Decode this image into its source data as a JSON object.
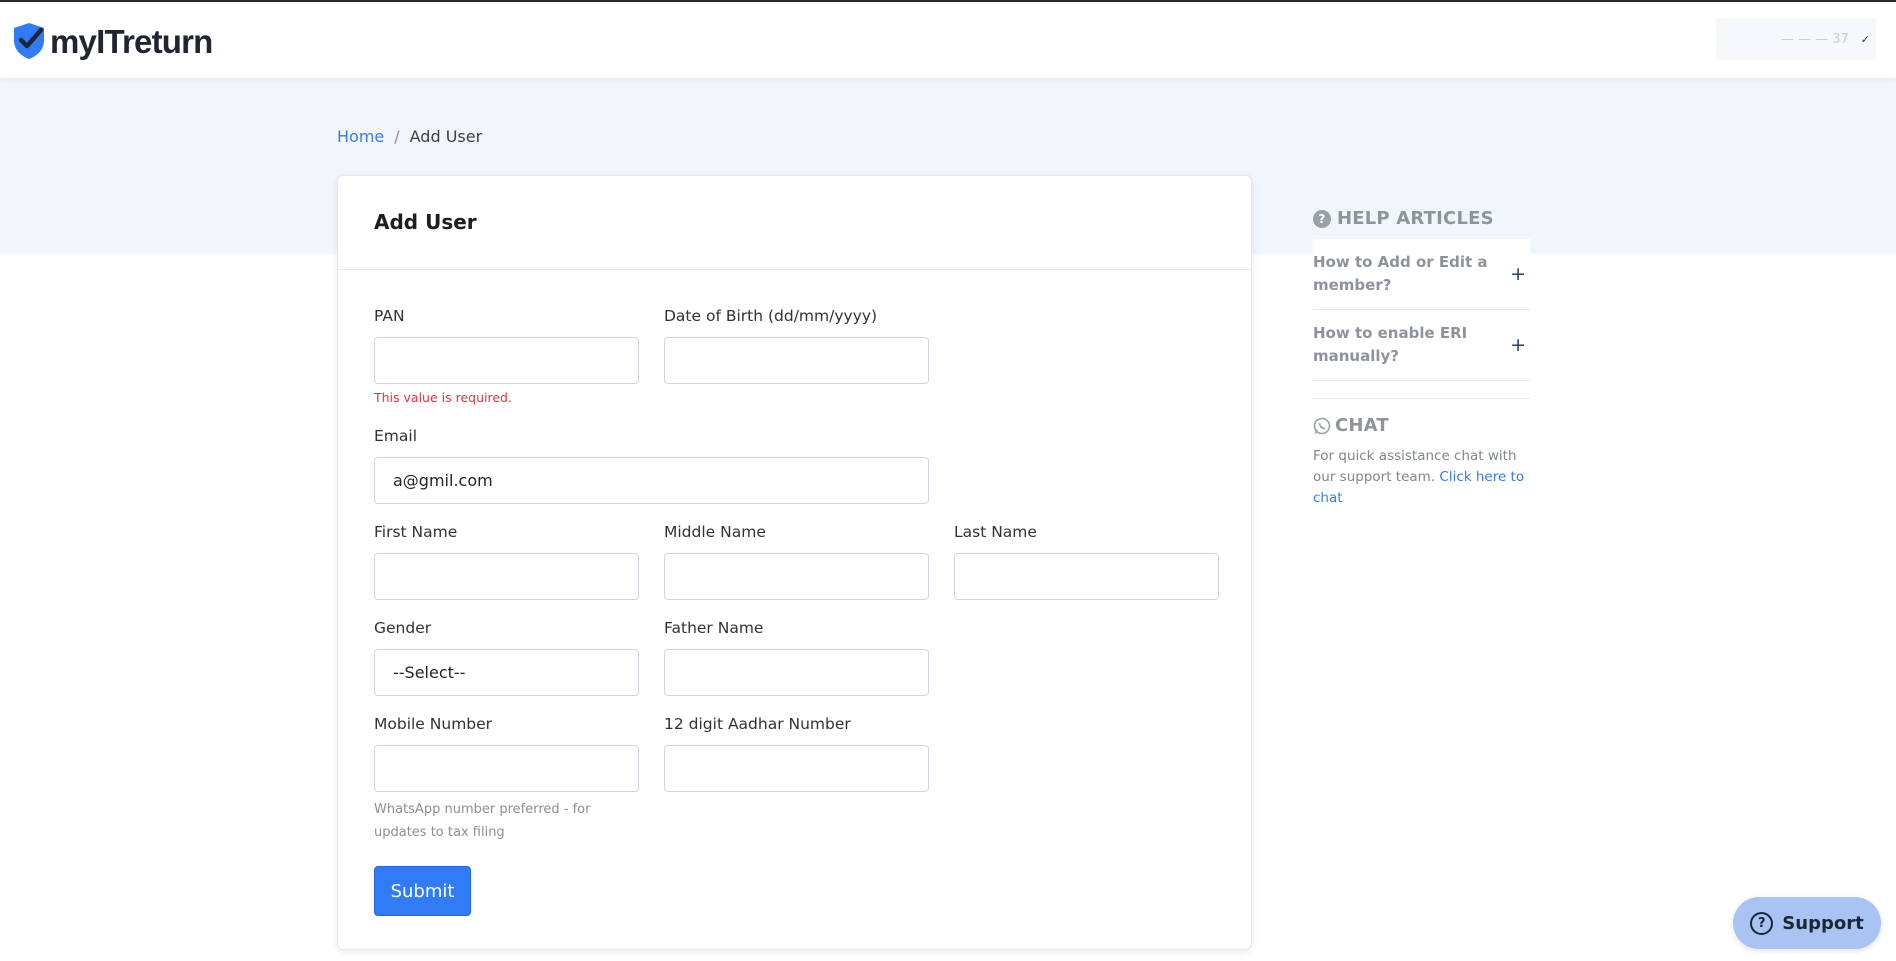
{
  "brand": {
    "name": "myITreturn",
    "color": "#2f7cf6"
  },
  "header": {
    "user_menu": "— — — 37"
  },
  "breadcrumb": {
    "home": "Home",
    "separator": "/",
    "current": "Add User"
  },
  "form": {
    "title": "Add User",
    "pan": {
      "label": "PAN",
      "value": "",
      "error": "This value is required."
    },
    "dob": {
      "label": "Date of Birth (dd/mm/yyyy)",
      "value": ""
    },
    "email": {
      "label": "Email",
      "value": "a@gmil.com"
    },
    "first_name": {
      "label": "First Name",
      "value": ""
    },
    "middle_name": {
      "label": "Middle Name",
      "value": ""
    },
    "last_name": {
      "label": "Last Name",
      "value": ""
    },
    "gender": {
      "label": "Gender",
      "value": "--Select--"
    },
    "father_name": {
      "label": "Father Name",
      "value": ""
    },
    "mobile": {
      "label": "Mobile Number",
      "value": "",
      "helper": "WhatsApp number preferred - for updates to tax filing"
    },
    "aadhar": {
      "label": "12 digit Aadhar Number",
      "value": ""
    },
    "submit_label": "Submit"
  },
  "sidebar": {
    "help_heading": "HELP ARTICLES",
    "articles": [
      {
        "title": "How to Add or Edit a member?"
      },
      {
        "title": "How to enable ERI manually?"
      }
    ],
    "chat_heading": "CHAT",
    "chat_text": "For quick assistance chat with our support team.",
    "chat_link": "Click here to chat"
  },
  "support": {
    "label": "Support"
  },
  "colors": {
    "error": "#dc3545",
    "link": "#3a7be0",
    "primary": "#2f7cf6",
    "hero_bg": "#f1f5fc"
  }
}
